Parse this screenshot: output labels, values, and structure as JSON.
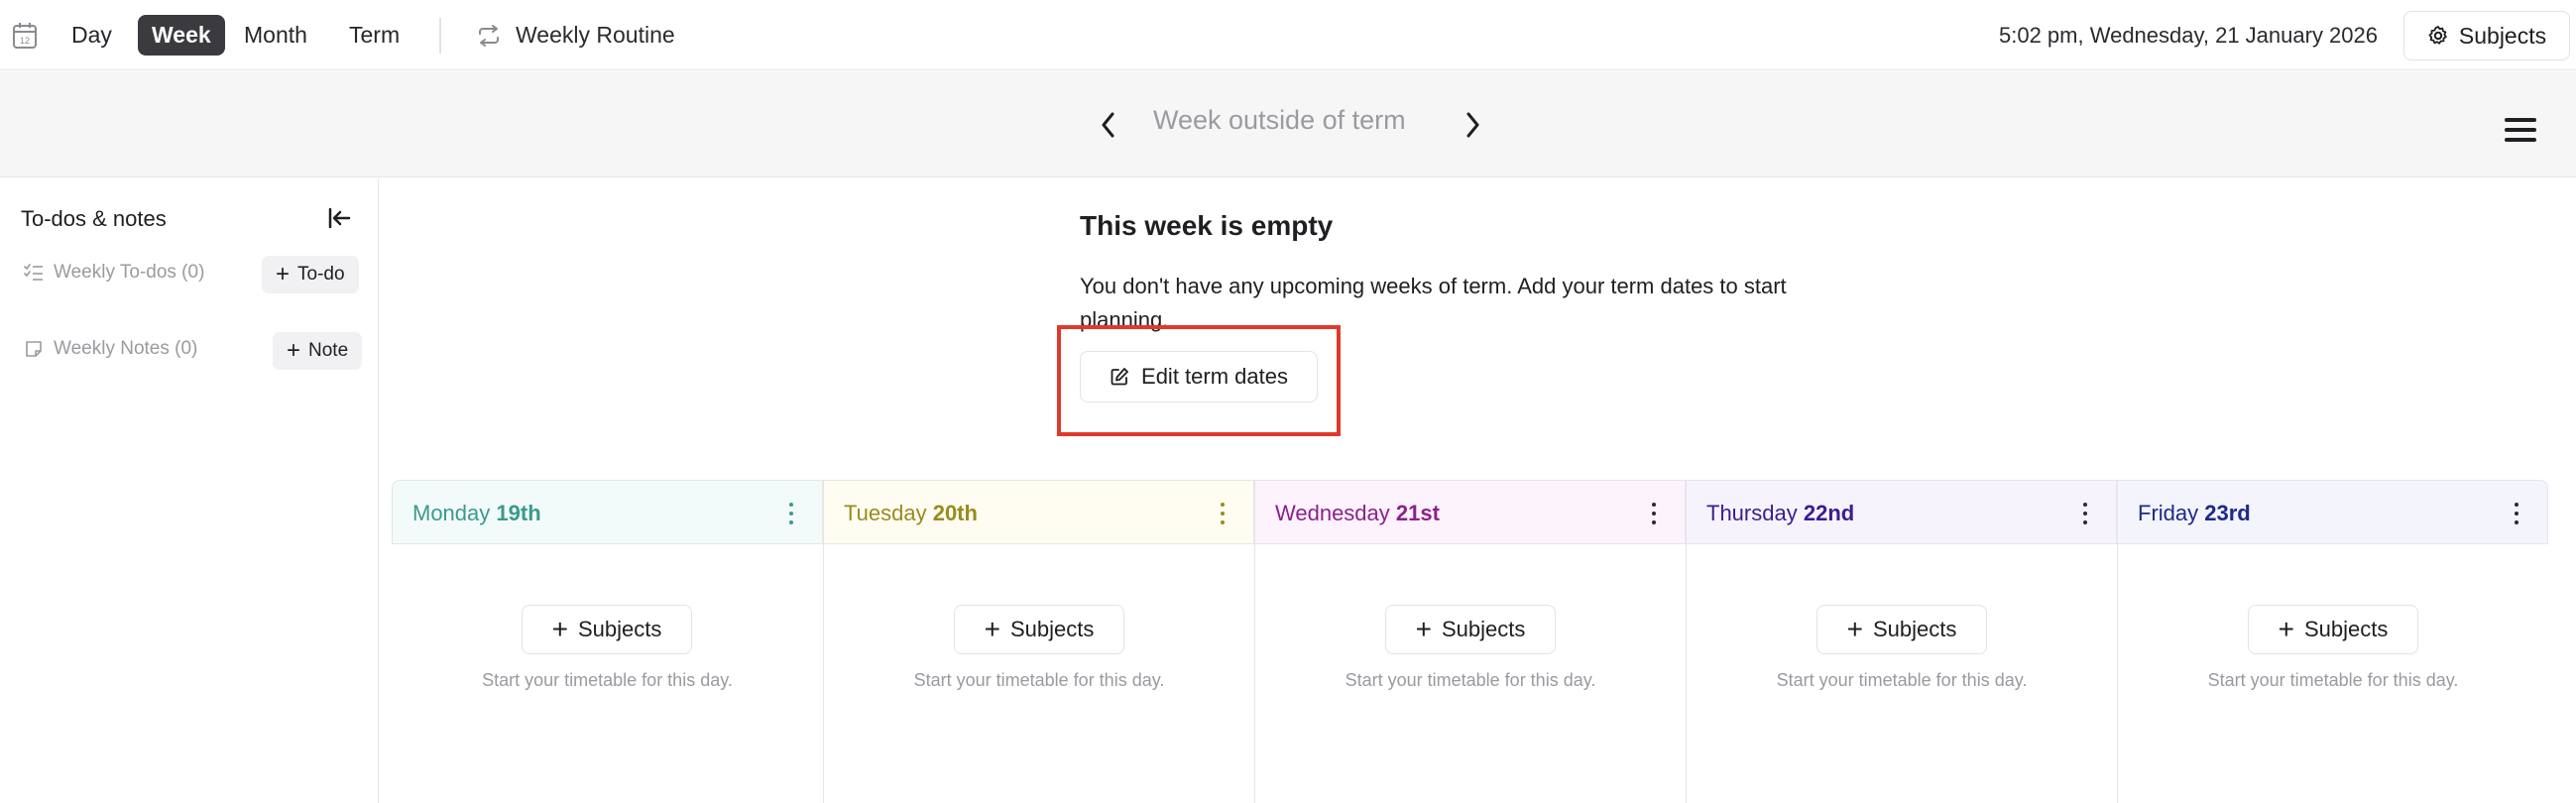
{
  "topbar": {
    "tabs": [
      {
        "label": "Day",
        "active": false
      },
      {
        "label": "Week",
        "active": true
      },
      {
        "label": "Month",
        "active": false
      },
      {
        "label": "Term",
        "active": false
      }
    ],
    "calendar_icon_day": "12",
    "routine_label": "Weekly Routine",
    "datetime": "5:02 pm, Wednesday, 21 January 2026",
    "subjects_label": "Subjects"
  },
  "weekbar": {
    "title": "Week outside of term"
  },
  "sidebar": {
    "title": "To-dos & notes",
    "todos_label": "Weekly To-dos (0)",
    "todo_button": "To-do",
    "notes_label": "Weekly Notes (0)",
    "note_button": "Note"
  },
  "empty": {
    "title": "This week is empty",
    "text": "You don't have any upcoming weeks of term. Add your term dates to start planning.",
    "edit_button": "Edit term dates"
  },
  "days": [
    {
      "name": "Monday",
      "date": "19th",
      "color": "#3a9a8f",
      "bg": "#f3fbfa",
      "dots": "#3a9a8f",
      "button": "Subjects",
      "hint": "Start your timetable for this day."
    },
    {
      "name": "Tuesday",
      "date": "20th",
      "color": "#9a8a1d",
      "bg": "#fffdf2",
      "dots": "#9a8a1d",
      "button": "Subjects",
      "hint": "Start your timetable for this day."
    },
    {
      "name": "Wednesday",
      "date": "21st",
      "color": "#8e1f8f",
      "bg": "#fcf3fc",
      "dots": "#2a2a2f",
      "button": "Subjects",
      "hint": "Start your timetable for this day."
    },
    {
      "name": "Thursday",
      "date": "22nd",
      "color": "#3c1d8f",
      "bg": "#f6f3fd",
      "dots": "#2a2a2f",
      "button": "Subjects",
      "hint": "Start your timetable for this day."
    },
    {
      "name": "Friday",
      "date": "23rd",
      "color": "#1d2a86",
      "bg": "#f3f4fc",
      "dots": "#2a2a2f",
      "button": "Subjects",
      "hint": "Start your timetable for this day."
    }
  ],
  "colors": {
    "highlight": "#e0392b",
    "active_tab": "#3b3b3f"
  }
}
